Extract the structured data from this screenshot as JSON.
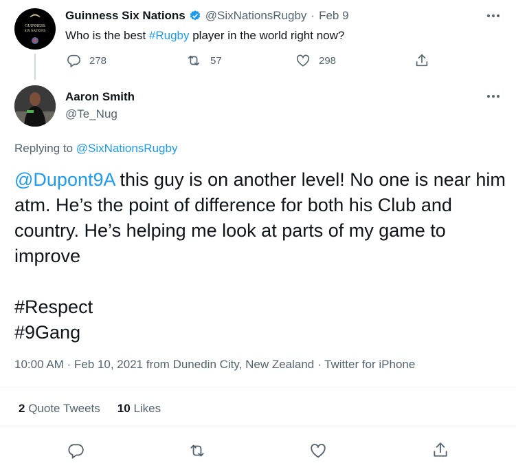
{
  "original_tweet": {
    "author_name": "Guinness Six Nations",
    "author_handle": "@SixNationsRugby",
    "separator": "·",
    "date": "Feb 9",
    "text_before": "Who is the best ",
    "hashtag": "#Rugby",
    "text_after": " player in the world right now?",
    "replies": "278",
    "retweets": "57",
    "likes": "298",
    "avatar_logo_lines": [
      "GUINNESS",
      "SIX NATIONS"
    ]
  },
  "reply_tweet": {
    "author_name": "Aaron Smith",
    "author_handle": "@Te_Nug",
    "replying_to_label": "Replying to",
    "replying_to_handle": "@SixNationsRugby",
    "mention": "@Dupont9A",
    "body_rest": " this guy is on another level! No one is near him atm. He’s the point of difference for both his Club and country. He’s helping me look at parts of my game to improve",
    "hashtag1": "#Respect",
    "hashtag2": "#9Gang",
    "meta": "10:00 AM · Feb 10, 2021 from Dunedin City, New Zealand · Twitter for iPhone",
    "quote_tweets_count": "2",
    "quote_tweets_label": "Quote Tweets",
    "likes_count": "10",
    "likes_label": "Likes"
  },
  "colors": {
    "accent": "#1d9bf0",
    "text": "#0f1419",
    "muted": "#536471",
    "verified": "#1d9bf0",
    "divider": "#eff3f4"
  },
  "icons": [
    "more-icon",
    "verified-badge-icon",
    "reply-icon",
    "retweet-icon",
    "like-icon",
    "share-icon"
  ]
}
